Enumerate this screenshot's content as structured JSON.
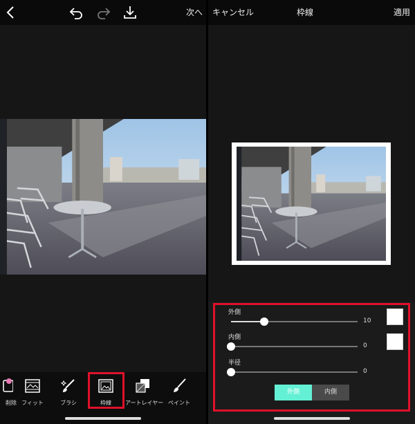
{
  "left": {
    "header": {
      "next_label": "次へ"
    },
    "toolbar": {
      "items": [
        {
          "label": "削除"
        },
        {
          "label": "フィット"
        },
        {
          "label": "ブラシ"
        },
        {
          "label": "枠線"
        },
        {
          "label": "アートレイヤー"
        },
        {
          "label": "ペイント"
        }
      ],
      "selected": "枠線"
    }
  },
  "right": {
    "header": {
      "cancel_label": "キャンセル",
      "title": "枠線",
      "apply_label": "適用"
    },
    "sliders": [
      {
        "label": "外側",
        "value": "10",
        "level": 0.26
      },
      {
        "label": "内側",
        "value": "0",
        "level": 0.0
      },
      {
        "label": "半径",
        "value": "0",
        "level": 0.0
      }
    ],
    "segmented": {
      "options": [
        "外側",
        "内側"
      ],
      "selected": "外側"
    },
    "colors": {
      "accent": "#64f0d4",
      "highlight": "#e0112b",
      "border_color": "#ffffff"
    }
  }
}
